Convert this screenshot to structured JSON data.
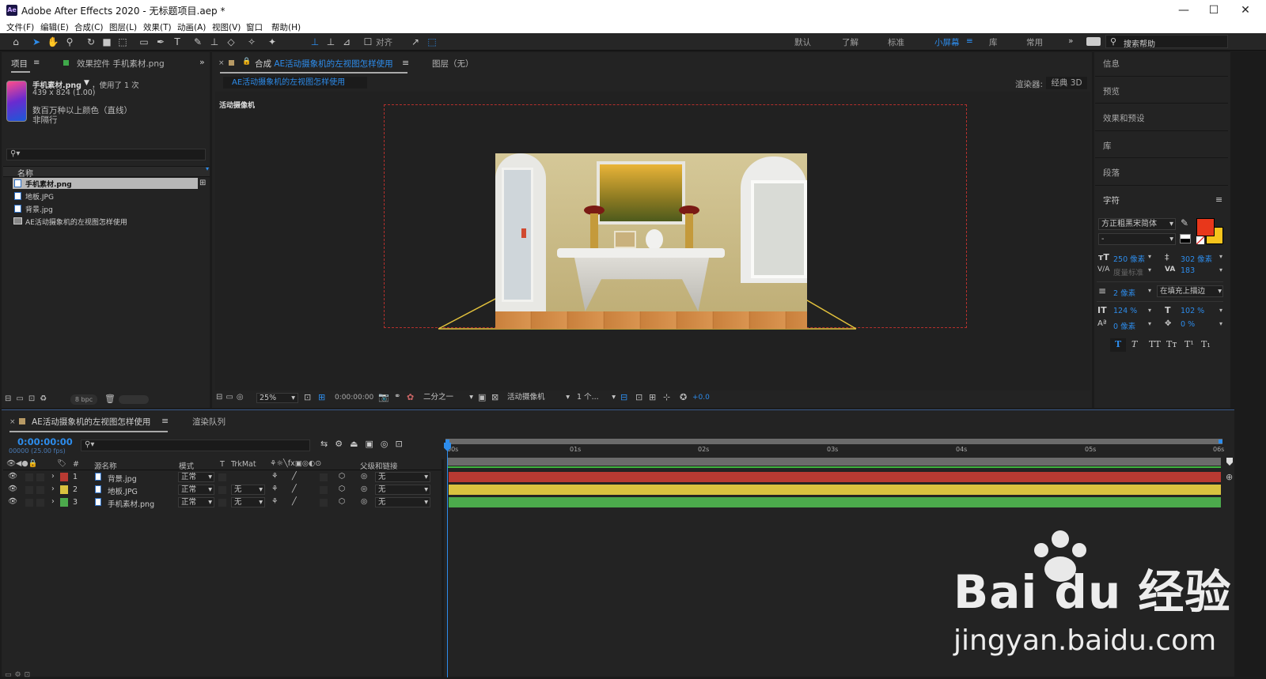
{
  "app": {
    "title": "Adobe After Effects 2020 - 无标题项目.aep *",
    "logo": "Ae"
  },
  "menu": [
    "文件(F)",
    "编辑(E)",
    "合成(C)",
    "图层(L)",
    "效果(T)",
    "动画(A)",
    "视图(V)",
    "窗口",
    "帮助(H)"
  ],
  "toolbar": {
    "snap_label": "对齐",
    "workspaces": [
      "默认",
      "了解",
      "标准",
      "小屏幕",
      "库",
      "常用"
    ],
    "active_workspace": "小屏幕",
    "search_placeholder": "搜索帮助"
  },
  "project": {
    "tab": "项目",
    "effects_tab": "效果控件 手机素材.png",
    "selected_name": "手机素材.png",
    "used": "，使用了 1 次",
    "dims": "439 x 824 (1.00)",
    "colors": "数百万种以上颜色（直线）",
    "interlace": "非隔行",
    "col_name": "名称",
    "items": [
      "手机素材.png",
      "地板.JPG",
      "背景.jpg",
      "AE活动摄象机的左视图怎样使用"
    ],
    "bpc": "8 bpc"
  },
  "comp": {
    "tab": "合成 AE活动摄象机的左视图怎样使用",
    "layer_tab": "图层（无）",
    "breadcrumb": "AE活动摄象机的左视图怎样使用",
    "renderer_label": "渲染器:",
    "renderer": "经典 3D",
    "view_label": "活动摄像机",
    "zoom": "25%",
    "timecode": "0:00:00:00",
    "resolution": "二分之一",
    "camera": "活动摄像机",
    "views": "1 个...",
    "exposure": "+0.0"
  },
  "right_panel": {
    "items": [
      "信息",
      "预览",
      "效果和预设",
      "库",
      "段落"
    ],
    "char_title": "字符",
    "font": "方正粗黑宋简体",
    "font_size": "250 像素",
    "leading": "302 像素",
    "kerning": "度量标准",
    "tracking": "183",
    "stroke": "2 像素",
    "stroke_mode": "在填充上描边",
    "vscale": "124 %",
    "hscale": "102 %",
    "baseline": "0 像素",
    "tsume": "0 %",
    "fill_color": "#e8371b",
    "stroke_color": "#f6c41c",
    "styles": [
      "T",
      "T",
      "TT",
      "Tт",
      "T¹",
      "T₁"
    ]
  },
  "timeline": {
    "tab": "AE活动摄象机的左视图怎样使用",
    "render_tab": "渲染队列",
    "timecode": "0:00:00:00",
    "frame": "00000 (25.00 fps)",
    "headers": {
      "num": "#",
      "source": "源名称",
      "mode": "模式",
      "t": "T",
      "trkmat": "TrkMat",
      "parent": "父级和链接"
    },
    "ruler": [
      "00s",
      "01s",
      "02s",
      "03s",
      "04s",
      "05s",
      "06s"
    ],
    "layers": [
      {
        "num": "1",
        "name": "背景.jpg",
        "mode": "正常",
        "trk": "",
        "parent": "无",
        "color": "#b83a32"
      },
      {
        "num": "2",
        "name": "地板.JPG",
        "mode": "正常",
        "trk": "无",
        "parent": "无",
        "color": "#d9c23f"
      },
      {
        "num": "3",
        "name": "手机素材.png",
        "mode": "正常",
        "trk": "无",
        "parent": "无",
        "color": "#4caa4c"
      }
    ]
  },
  "watermark": {
    "brand": "Bai du 经验",
    "url": "jingyan.baidu.com"
  }
}
